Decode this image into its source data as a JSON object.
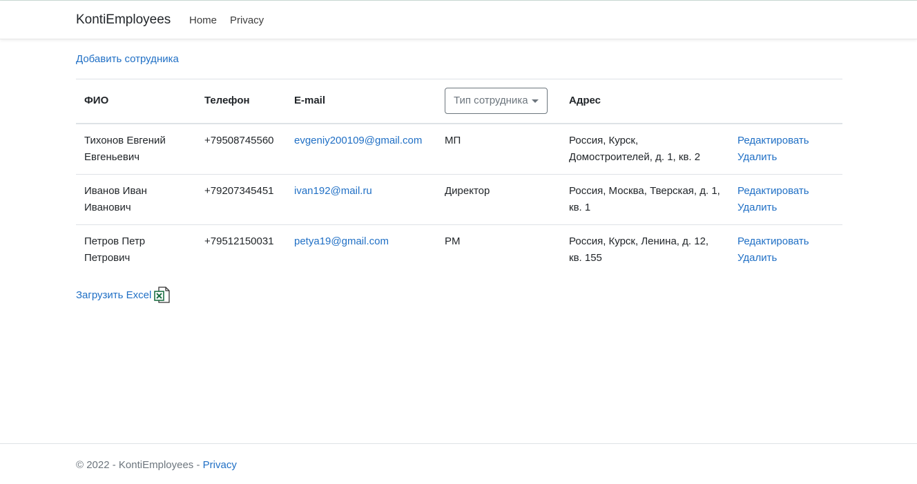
{
  "navbar": {
    "brand": "KontiEmployees",
    "links": [
      "Home",
      "Privacy"
    ]
  },
  "main": {
    "add_link": "Добавить сотрудника",
    "table": {
      "headers": {
        "fio": "ФИО",
        "phone": "Телефон",
        "email": "E-mail",
        "type_dropdown": "Тип сотрудника",
        "address": "Адрес"
      },
      "rows": [
        {
          "fio": "Тихонов Евгений Евгеньевич",
          "phone": "+79508745560",
          "email": "evgeniy200109@gmail.com",
          "type": "МП",
          "address": "Россия, Курск, Домостроителей, д. 1, кв. 2",
          "edit": "Редактировать",
          "delete": "Удалить"
        },
        {
          "fio": "Иванов Иван Иванович",
          "phone": "+79207345451",
          "email": "ivan192@mail.ru",
          "type": "Директор",
          "address": "Россия, Москва, Тверская, д. 1, кв. 1",
          "edit": "Редактировать",
          "delete": "Удалить"
        },
        {
          "fio": "Петров Петр Петрович",
          "phone": "+79512150031",
          "email": "petya19@gmail.com",
          "type": "PM",
          "address": "Россия, Курск, Ленина, д. 12, кв. 155",
          "edit": "Редактировать",
          "delete": "Удалить"
        }
      ]
    },
    "excel_link": "Загрузить Excel",
    "excel_icon": "excel-file-icon"
  },
  "footer": {
    "text": "© 2022 - KontiEmployees - ",
    "privacy_link": "Privacy"
  },
  "colors": {
    "link": "#1f6fc5",
    "text": "#212529",
    "muted": "#6c757d",
    "excel_green": "#1d7044"
  }
}
